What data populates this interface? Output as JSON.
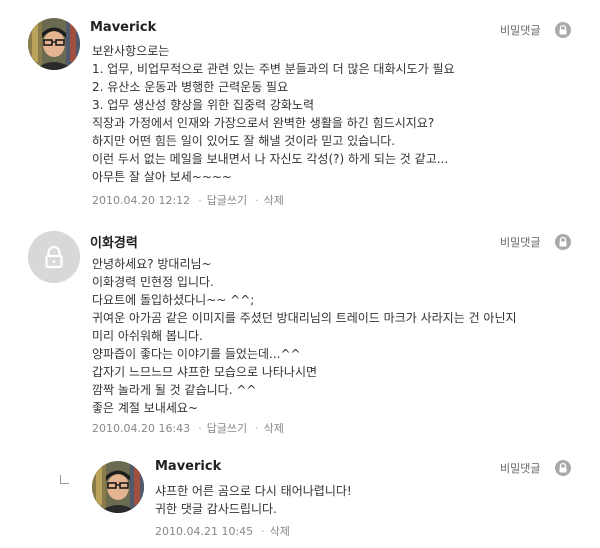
{
  "comments": [
    {
      "author": "Maverick",
      "secret_label": "비밀댓글",
      "lines": [
        "보완사항으로는",
        "1. 업무, 비업무적으로 관련 있는 주변 분들과의 더 많은 대화시도가 필요",
        "2. 유산소 운동과 병행한 근력운동 필요",
        "3. 업무 생산성 향상을 위한 집중력 강화노력",
        "직장과 가정에서 인재와 가장으로서 완벽한 생활을 하긴 힘드시지요?",
        "하지만 어떤 힘든 일이 있어도 잘 해낼 것이라 믿고 있습니다.",
        "이런 두서 없는 메일을 보내면서 나 자신도 각성(?) 하게 되는 것 같고...",
        "아무튼 잘 살아 보세~~~~"
      ],
      "date": "2010.04.20 12:12",
      "reply_label": "답글쓰기",
      "delete_label": "삭제"
    },
    {
      "author": "이화경력",
      "secret_label": "비밀댓글",
      "lines": [
        "안녕하세요? 방대리님~",
        "이화경력 민현정 입니다.",
        "다요트에 돌입하셨다니~~ ^^;",
        "귀여운 아가곰 같은 이미지를 주셨던 방대리님의 트레이드 마크가 사라지는 건 아닌지",
        "미리 아쉬워해 봅니다.",
        "양파즙이 좋다는 이야기를 들었는데...^^",
        "갑자기 느므느므 샤프한 모습으로 나타나시면",
        "깜짝 놀라게 될 것 같습니다. ^^",
        "좋은 계절 보내세요~"
      ],
      "date": "2010.04.20 16:43",
      "reply_label": "답글쓰기",
      "delete_label": "삭제"
    },
    {
      "author": "Maverick",
      "secret_label": "비밀댓글",
      "lines": [
        "샤프한 어른 곰으로 다시 태어나렵니다!",
        "귀한 댓글 감사드립니다."
      ],
      "date": "2010.04.21 10:45",
      "delete_label": "삭제"
    }
  ],
  "icons": {
    "avatar_photo": "user-photo-avatar",
    "avatar_locked": "lock-avatar",
    "secret_button": "lock-icon",
    "reply_marker": "reply-corner-icon"
  },
  "colors": {
    "text": "#333333",
    "meta": "#888888",
    "lock_bg": "#a9a9a9",
    "placeholder_avatar": "#d8d8d8"
  }
}
